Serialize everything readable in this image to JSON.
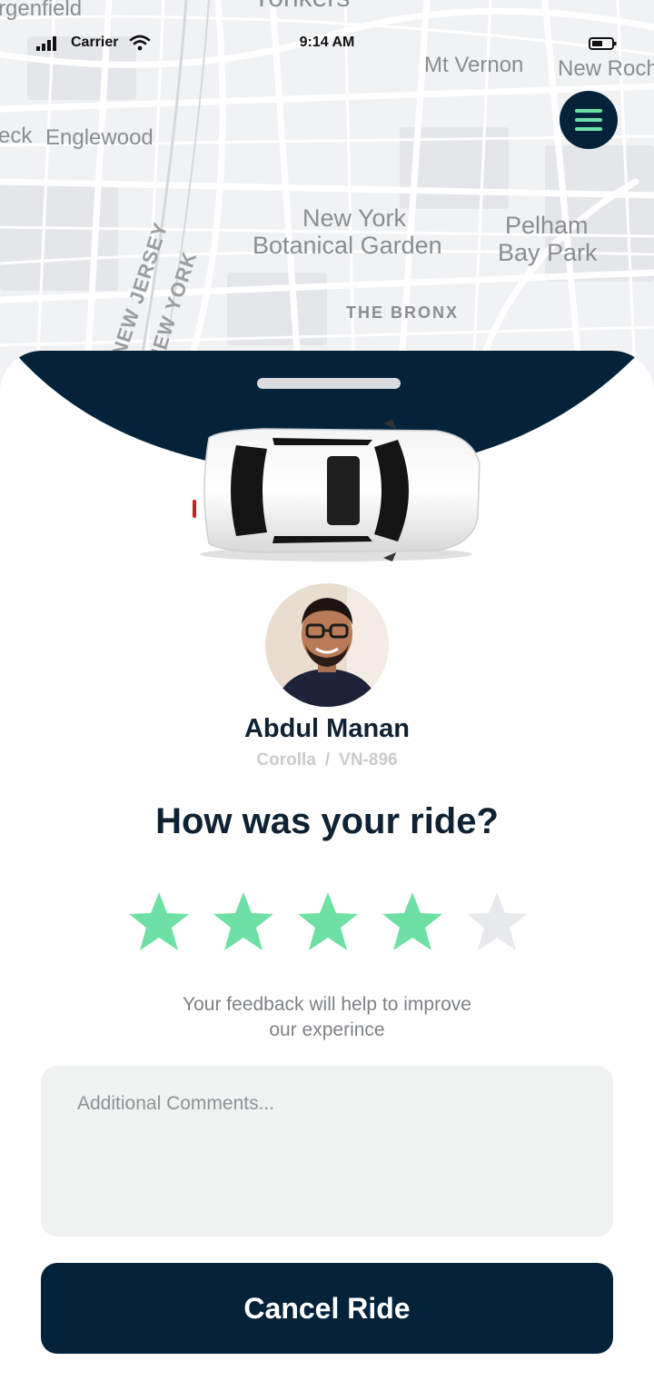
{
  "status_bar": {
    "carrier": "Carrier",
    "time": "9:14 AM",
    "signal_icon": "signal-bars-icon",
    "wifi_icon": "wifi-icon",
    "battery_icon": "battery-icon"
  },
  "map": {
    "labels": {
      "bergenfield": "rgenfield",
      "yonkers": "Yonkers",
      "mt_vernon": "Mt Vernon",
      "new_rochelle": "New Roch",
      "teaneck": "eck",
      "englewood": "Englewood",
      "botanical_line1": "New York",
      "botanical_line2": "Botanical Garden",
      "pelham_line1": "Pelham",
      "pelham_line2": "Bay Park",
      "new_jersey": "NEW JERSEY",
      "new_york": "NEW YORK",
      "bronx": "THE BRONX"
    },
    "menu_icon": "hamburger-menu-icon"
  },
  "colors": {
    "navy": "#04233a",
    "accent_green": "#6ee0a4",
    "star_empty": "#e8e9ea"
  },
  "driver": {
    "name": "Abdul Manan",
    "car_model": "Corolla",
    "separator": "/",
    "plate": "VN-896"
  },
  "rating": {
    "question": "How was your ride?",
    "value": 4,
    "max": 5,
    "feedback_line1": "Your feedback will help to improve",
    "feedback_line2": "our experince"
  },
  "comments": {
    "placeholder": "Additional Comments..."
  },
  "actions": {
    "cancel_label": "Cancel Ride"
  }
}
